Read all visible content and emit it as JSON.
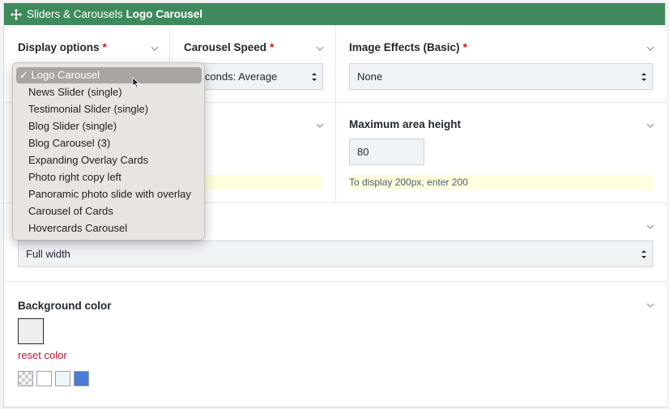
{
  "header": {
    "prefix": "Sliders & Carousels",
    "title": "Logo Carousel"
  },
  "display_options": {
    "label": "Display options",
    "required": "*"
  },
  "carousel_speed": {
    "label": "Carousel Speed",
    "required": "*",
    "value": "Seconds: Average"
  },
  "image_effects": {
    "label": "Image Effects (Basic)",
    "required": "*",
    "value": "None"
  },
  "max_height": {
    "label": "Maximum area height",
    "value": "80",
    "hint": "To display 200px, enter 200"
  },
  "width": {
    "value": "Full width"
  },
  "background": {
    "label": "Background color",
    "reset": "reset color"
  },
  "swatch_colors": [
    "checker",
    "#ffffff",
    "#eef6fb",
    "#4a7bd6"
  ],
  "dropdown": {
    "options": [
      {
        "label": "✓ Logo Carousel",
        "selected": true
      },
      {
        "label": "News Slider (single)"
      },
      {
        "label": "Testimonial Slider (single)"
      },
      {
        "label": "Blog Slider (single)"
      },
      {
        "label": "Blog Carousel (3)"
      },
      {
        "label": "Expanding Overlay Cards"
      },
      {
        "label": "Photo right copy left"
      },
      {
        "label": "Panoramic photo slide with overlay"
      },
      {
        "label": "Carousel of Cards"
      },
      {
        "label": "Hovercards Carousel"
      }
    ]
  },
  "colors": {
    "header_bg": "#3f8a5c",
    "required": "#d11b1b",
    "reset": "#c8102e",
    "hint_bg": "#ffffdd"
  }
}
